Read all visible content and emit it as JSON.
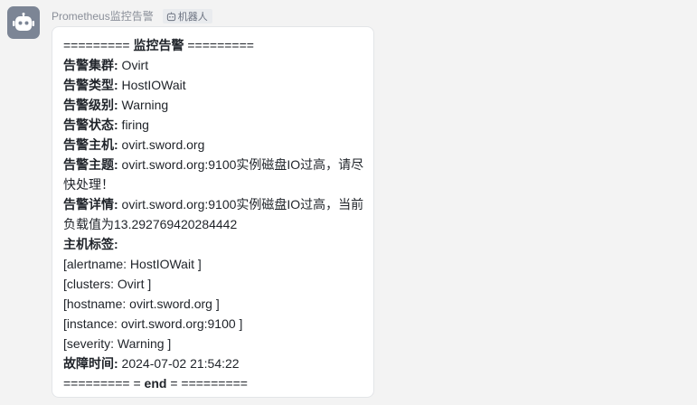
{
  "sender": {
    "name": "Prometheus监控告警",
    "tag": "机器人",
    "avatar_icon": "robot-icon",
    "tag_icon": "robot-small-icon"
  },
  "message": {
    "banner_left": "========= ",
    "banner_title": "监控告警",
    "banner_right": " =========",
    "fields": {
      "cluster": {
        "label": "告警集群:",
        "value": " Ovirt"
      },
      "type": {
        "label": "告警类型:",
        "value": " HostIOWait"
      },
      "level": {
        "label": "告警级别:",
        "value": " Warning"
      },
      "status": {
        "label": "告警状态:",
        "value": " firing"
      },
      "host": {
        "label": "告警主机:",
        "value": " ovirt.sword.org"
      },
      "subject": {
        "label": "告警主题:",
        "value": " ovirt.sword.org:9100实例磁盘IO过高，请尽快处理！"
      },
      "detail": {
        "label": "告警详情:",
        "value": " ovirt.sword.org:9100实例磁盘IO过高，当前负载值为13.292769420284442"
      }
    },
    "host_labels_title": "主机标签:",
    "host_labels": [
      "[alertname: HostIOWait ]",
      "[clusters: Ovirt ]",
      "[hostname: ovirt.sword.org ]",
      "[instance: ovirt.sword.org:9100 ]",
      "[severity: Warning ]"
    ],
    "fault_time": {
      "label": "故障时间:",
      "value": " 2024-07-02 21:54:22"
    },
    "footer_left": "========= = ",
    "footer_title": "end",
    "footer_right": " = ========="
  },
  "colors": {
    "background": "#f3f3f3",
    "avatar": "#7c8595",
    "bubble": "#ffffff",
    "text": "#1f2329",
    "muted": "#8a8f99"
  }
}
